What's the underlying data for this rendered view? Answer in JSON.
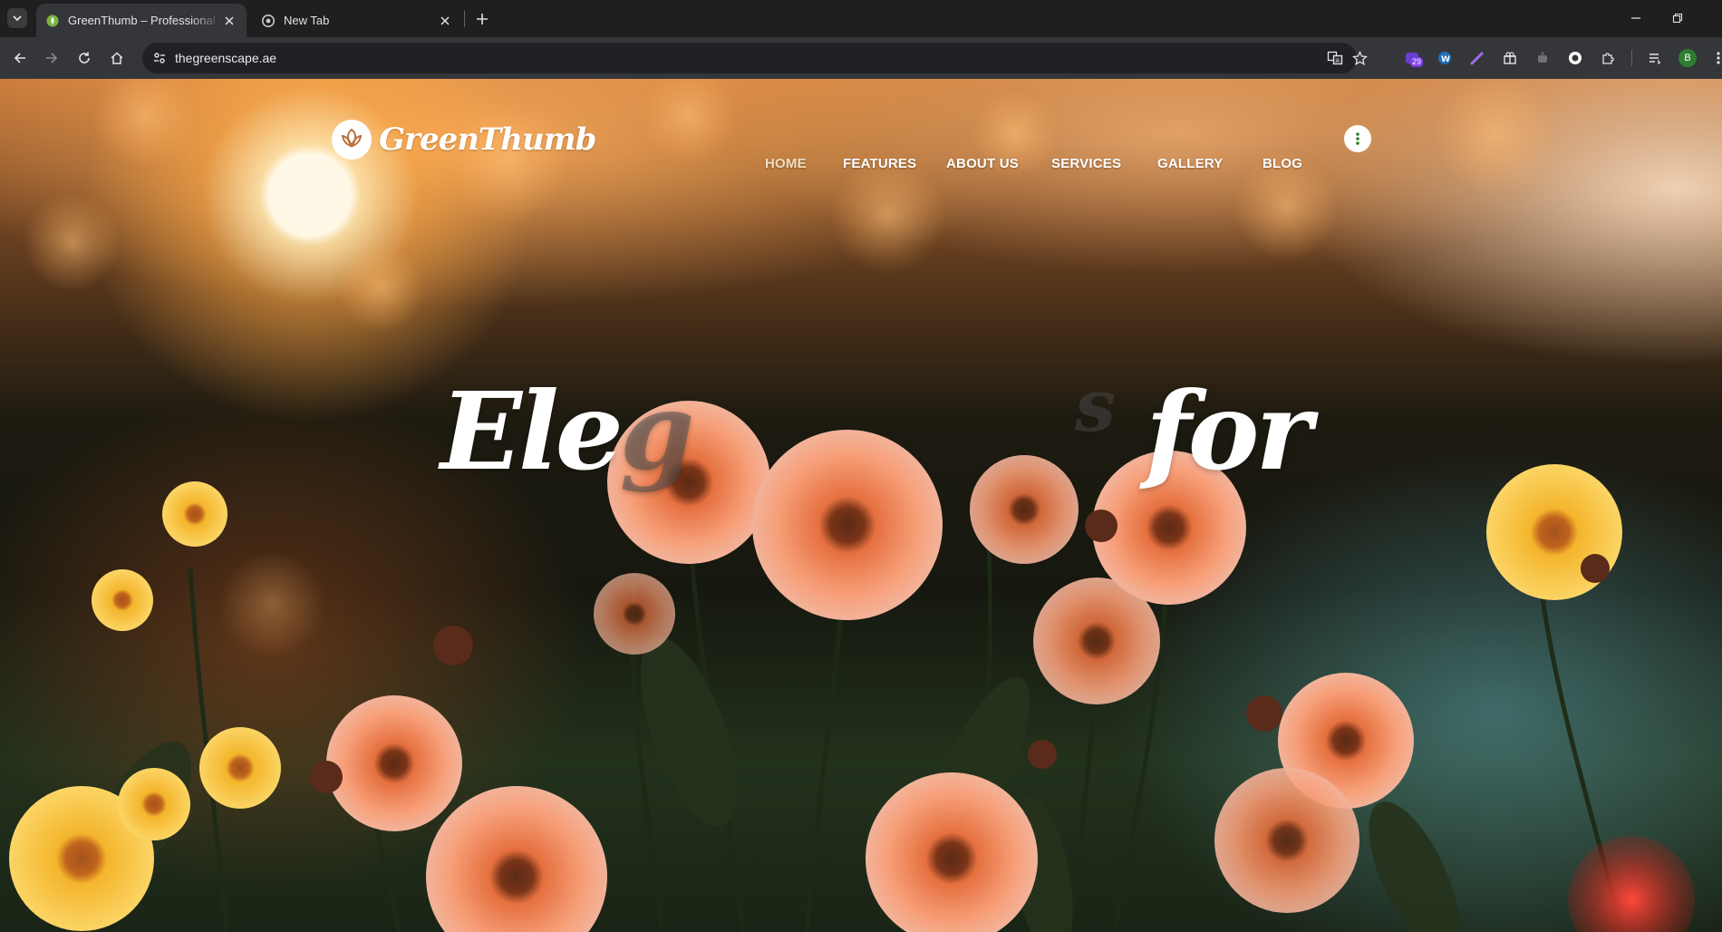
{
  "browser": {
    "tabs": [
      {
        "title": "GreenThumb – Professional Garden",
        "active": true
      },
      {
        "title": "New Tab",
        "active": false
      }
    ],
    "url": "thegreenscape.ae",
    "extension_badge": "29",
    "profile_initial": "B"
  },
  "site": {
    "brand": "GreenThumb",
    "nav": [
      "HOME",
      "FEATURES",
      "ABOUT US",
      "SERVICES",
      "GALLERY",
      "BLOG"
    ],
    "nav_current": "HOME",
    "hero": {
      "part1": "Ele",
      "part1_fading": "g",
      "fading_letter": "s",
      "part2": "for"
    }
  },
  "colors": {
    "chrome_tabbar": "#1f1f20",
    "chrome_toolbar": "#35363a",
    "omnibox": "#202124",
    "nav_text": "#ffffff",
    "accent_green": "#2e7d32"
  }
}
